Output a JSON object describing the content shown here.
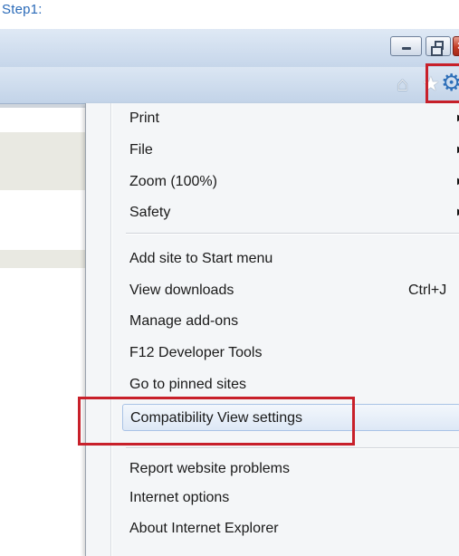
{
  "step_label": "Step1:",
  "window_controls": {
    "minimize": "minimize-icon",
    "restore": "restore-icon",
    "close_glyph": "×"
  },
  "toolbar": {
    "home_glyph": "⌂",
    "favorites_glyph": "★",
    "tools_glyph": "⚙"
  },
  "menu": {
    "items": [
      {
        "label": "Print",
        "submenu": true
      },
      {
        "label": "File",
        "submenu": true
      },
      {
        "label": "Zoom (100%)",
        "submenu": true
      },
      {
        "label": "Safety",
        "submenu": true
      },
      {
        "label": "Add site to Start menu"
      },
      {
        "label": "View downloads",
        "shortcut": "Ctrl+J"
      },
      {
        "label": "Manage add-ons"
      },
      {
        "label": "F12 Developer Tools"
      },
      {
        "label": "Go to pinned sites"
      },
      {
        "label": "Compatibility View settings",
        "highlighted": true
      },
      {
        "label": "Report website problems"
      },
      {
        "label": "Internet options"
      },
      {
        "label": "About Internet Explorer"
      }
    ],
    "arrow_glyph": "▶"
  },
  "colors": {
    "callout": "#c8202a",
    "step_label": "#2a6ab8",
    "tools_icon": "#2e6fb8"
  }
}
